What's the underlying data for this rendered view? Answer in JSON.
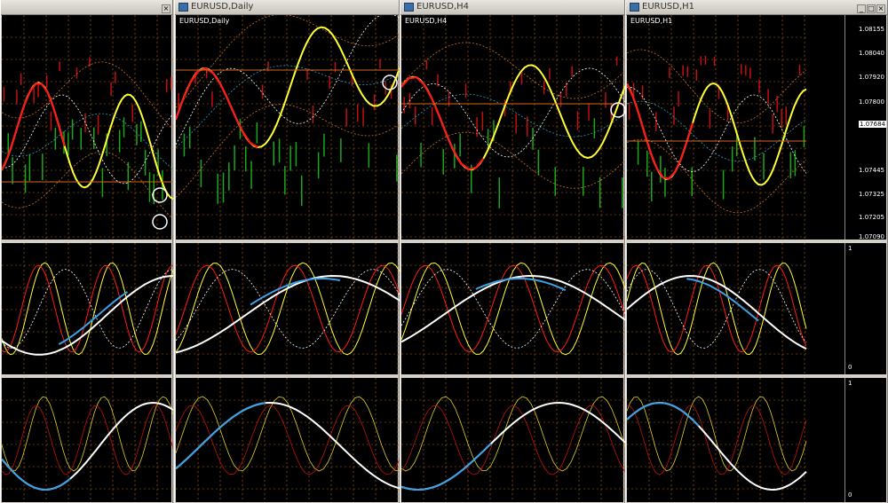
{
  "windows": [
    {
      "id": "w1",
      "title": "",
      "symbol": "",
      "x_left": 0
    },
    {
      "id": "w2",
      "title": "EURUSD,Daily",
      "symbol": "EURUSD,Daily"
    },
    {
      "id": "w3",
      "title": "EURUSD,H4",
      "symbol": "EURUSD,H4"
    },
    {
      "id": "w4",
      "title": "EURUSD,H1",
      "symbol": "EURUSD,H1"
    }
  ],
  "price_axis": {
    "labels": [
      "1.08155",
      "1.08040",
      "1.07920",
      "1.07800",
      "1.07684",
      "1.07445",
      "1.07325",
      "1.07205",
      "1.07090"
    ],
    "current_price": "1.07684",
    "osc_top": "1",
    "osc_bottom": "0"
  },
  "title_buttons": {
    "min": "_",
    "max": "□",
    "close": "×"
  }
}
